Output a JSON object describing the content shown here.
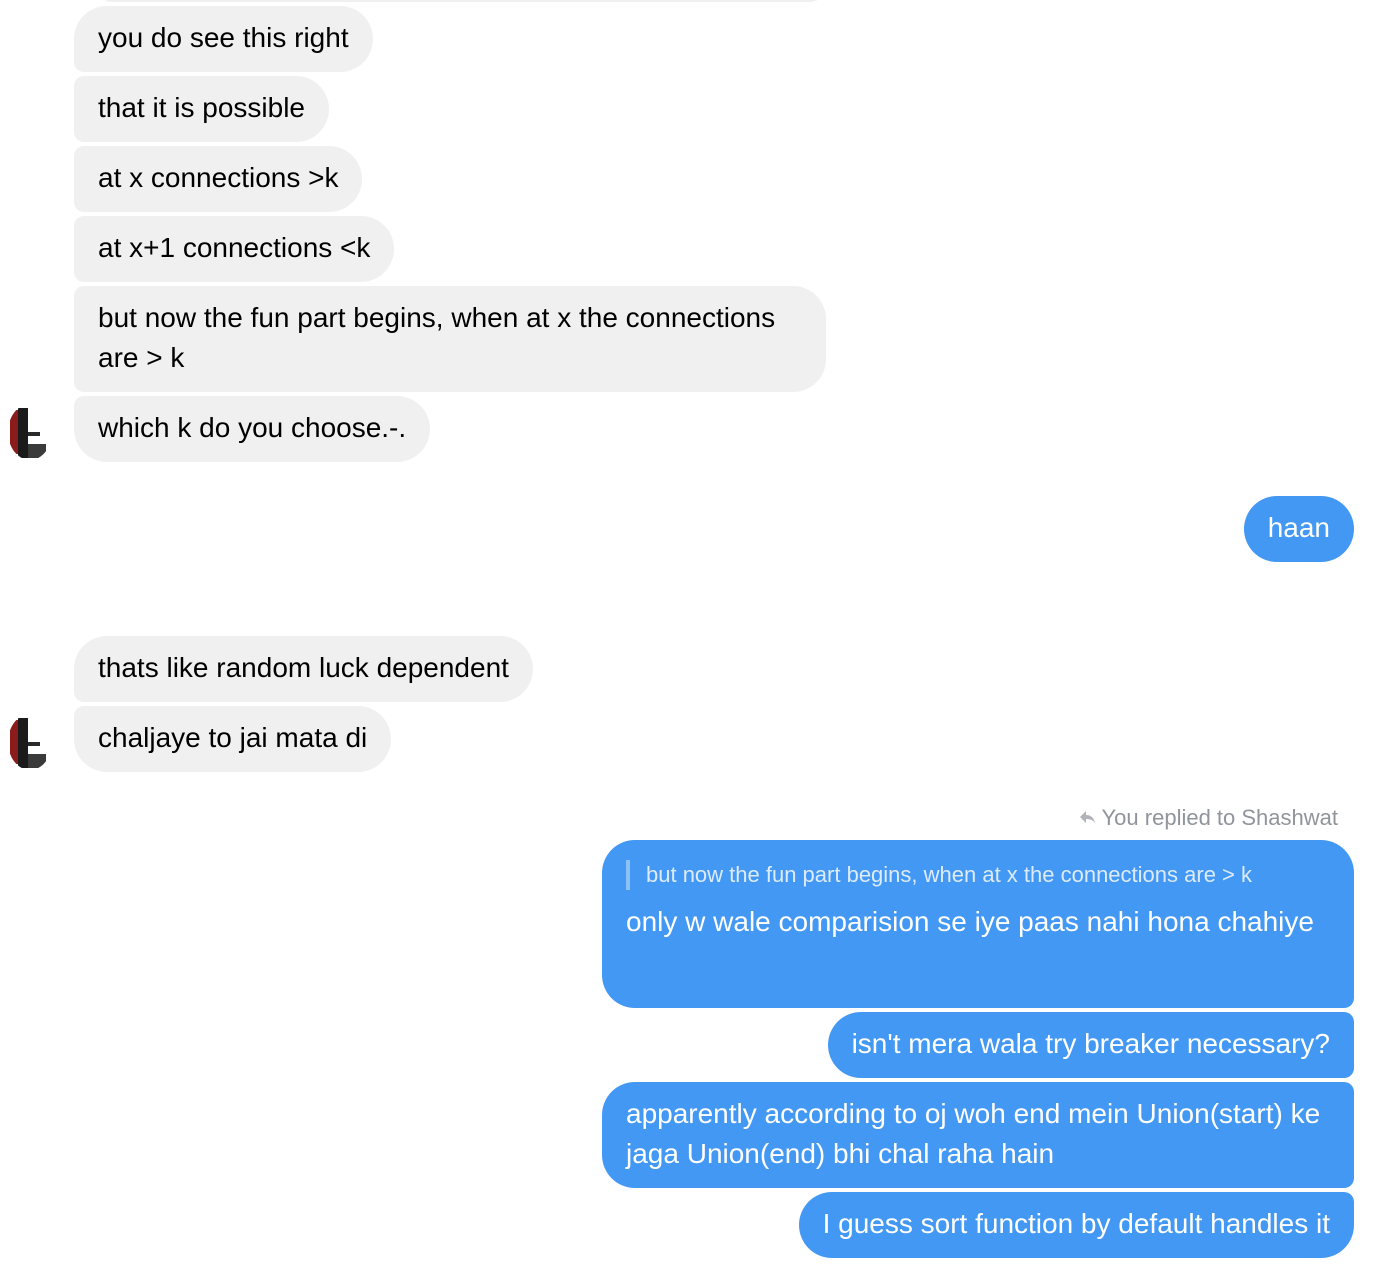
{
  "conversation": {
    "group1": [
      "you do see this right",
      "that it is possible",
      "at x connections >k",
      "at x+1 connections <k",
      "but now the fun part begins, when at x the connections are > k",
      "which k do you choose.-."
    ],
    "me1": "haan",
    "group2": [
      "thats like random luck dependent",
      "chaljaye to jai mata di"
    ],
    "reply_label": "You replied to Shashwat",
    "quoted_text": "but now the fun part begins, when at x the connections are > k",
    "me2": [
      "only w wale comparision se iye paas nahi hona chahiye",
      "isn't mera wala try breaker necessary?",
      "apparently according to oj woh end mein Union(start) ke jaga Union(end) bhi chal raha hain",
      "I guess sort function by default handles it"
    ]
  },
  "icons": {
    "reply": "reply-arrow-icon",
    "avatar": "contact-avatar"
  },
  "colors": {
    "incoming_bubble": "#f1f0f0",
    "outgoing_bubble": "#4398f4",
    "meta_text": "#90949c"
  }
}
